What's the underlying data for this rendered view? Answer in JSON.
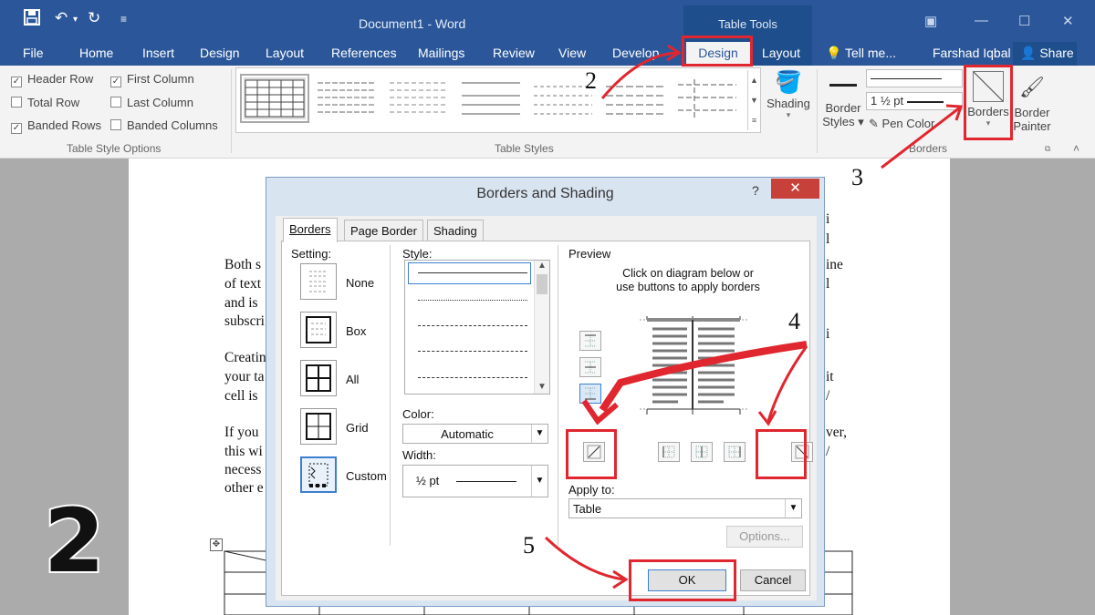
{
  "window": {
    "doc_title": "Document1 - Word",
    "table_tools": "Table Tools",
    "user": "Farshad Iqbal",
    "share": "Share",
    "tell_me": "Tell me..."
  },
  "tabs": [
    "File",
    "Home",
    "Insert",
    "Design",
    "Layout",
    "References",
    "Mailings",
    "Review",
    "View",
    "Develop"
  ],
  "contextual_tabs": {
    "design": "Design",
    "layout": "Layout"
  },
  "table_style_options": {
    "items": [
      {
        "label": "Header Row",
        "checked": true
      },
      {
        "label": "First Column",
        "checked": true
      },
      {
        "label": "Total Row",
        "checked": false
      },
      {
        "label": "Last Column",
        "checked": false
      },
      {
        "label": "Banded Rows",
        "checked": true
      },
      {
        "label": "Banded Columns",
        "checked": false
      }
    ],
    "group_label": "Table Style Options"
  },
  "table_styles": {
    "group_label": "Table Styles",
    "shading": "Shading"
  },
  "borders_group": {
    "border_styles_1": "Border",
    "border_styles_2": "Styles",
    "weight": "1 ½ pt",
    "pen_color": "Pen Color",
    "borders_btn": "Borders",
    "border_painter_1": "Border",
    "border_painter_2": "Painter",
    "group_label": "Borders"
  },
  "document": {
    "lines_left": [
      "Both s",
      "of text",
      "and is",
      "subscri",
      "Creatin",
      "your ta",
      "cell is",
      "If you",
      "this wi",
      "necess",
      "other e"
    ],
    "lines_right": [
      "i",
      "l",
      "ine",
      "l",
      "i",
      "it",
      "/",
      "ver,",
      "/"
    ]
  },
  "dialog": {
    "title": "Borders and Shading",
    "help": "?",
    "tabs": [
      "Borders",
      "Page Border",
      "Shading"
    ],
    "setting_label": "Setting:",
    "settings": [
      "None",
      "Box",
      "All",
      "Grid",
      "Custom"
    ],
    "style_label": "Style:",
    "color_label": "Color:",
    "color_value": "Automatic",
    "width_label": "Width:",
    "width_value": "½ pt",
    "preview_label": "Preview",
    "preview_hint_1": "Click on diagram below or",
    "preview_hint_2": "use buttons to apply borders",
    "apply_to_label": "Apply to:",
    "apply_to_value": "Table",
    "options_btn": "Options...",
    "ok_btn": "OK",
    "cancel_btn": "Cancel"
  },
  "annotations": {
    "n2": "2",
    "n3": "3",
    "n4": "4",
    "n5": "5",
    "big": "2"
  },
  "colors": {
    "brand": "#2b579a",
    "highlight": "#e0262f",
    "dialog_bg": "#d9e4f1"
  }
}
